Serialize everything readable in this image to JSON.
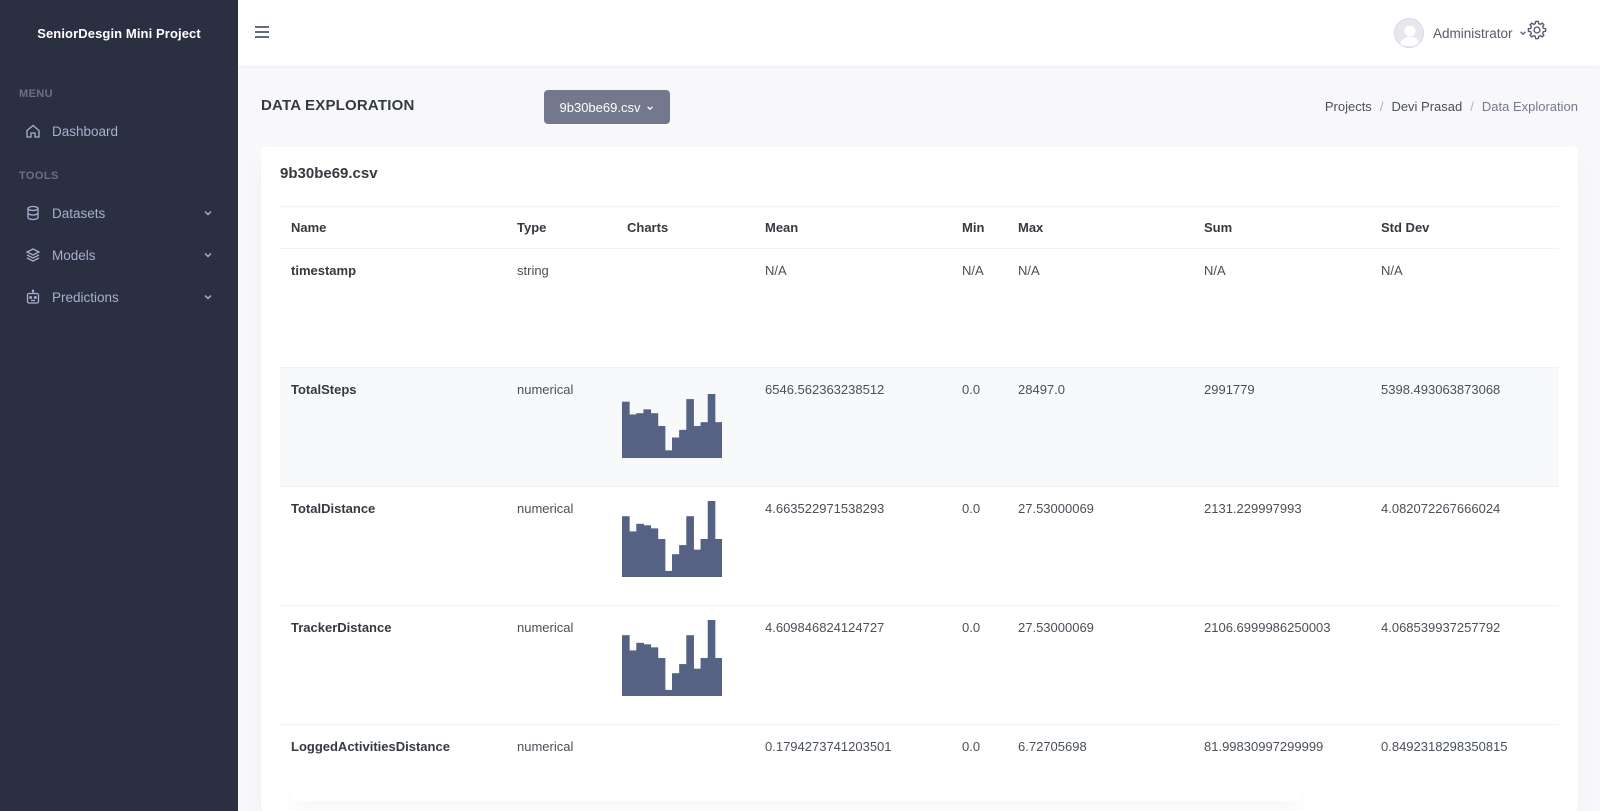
{
  "brand": "SeniorDesgin Mini Project",
  "sidebar": {
    "menu_title": "MENU",
    "tools_title": "TOOLS",
    "items": [
      {
        "label": "Dashboard",
        "icon": "home-icon"
      },
      {
        "label": "Datasets",
        "icon": "database-icon"
      },
      {
        "label": "Models",
        "icon": "layers-icon"
      },
      {
        "label": "Predictions",
        "icon": "bot-icon"
      }
    ]
  },
  "topbar": {
    "user_name": "Administrator"
  },
  "page": {
    "title": "DATA EXPLORATION",
    "file_dropdown": "9b30be69.csv",
    "breadcrumb": [
      "Projects",
      "Devi Prasad",
      "Data Exploration"
    ]
  },
  "card": {
    "title": "9b30be69.csv",
    "columns": [
      "Name",
      "Type",
      "Charts",
      "Mean",
      "Min",
      "Max",
      "Sum",
      "Std Dev"
    ],
    "rows": [
      {
        "name": "timestamp",
        "type": "string",
        "mean": "N/A",
        "min": "N/A",
        "max": "N/A",
        "sum": "N/A",
        "std": "N/A",
        "hist": []
      },
      {
        "name": "TotalSteps",
        "type": "numerical",
        "mean": "6546.562363238512",
        "min": "0.0",
        "max": "28497.0",
        "sum": "2991779",
        "std": "5398.493063873068",
        "hist": [
          0.88,
          0.68,
          0.7,
          0.76,
          0.7,
          0.5,
          0.12,
          0.32,
          0.44,
          0.92,
          0.5,
          0.56,
          1.0,
          0.56
        ]
      },
      {
        "name": "TotalDistance",
        "type": "numerical",
        "mean": "4.663522971538293",
        "min": "0.0",
        "max": "27.53000069",
        "sum": "2131.229997993",
        "std": "4.082072267666024",
        "hist": [
          0.8,
          0.6,
          0.7,
          0.68,
          0.64,
          0.5,
          0.08,
          0.3,
          0.42,
          0.8,
          0.36,
          0.5,
          1.0,
          0.5
        ]
      },
      {
        "name": "TrackerDistance",
        "type": "numerical",
        "mean": "4.609846824124727",
        "min": "0.0",
        "max": "27.53000069",
        "sum": "2106.6999986250003",
        "std": "4.068539937257792",
        "hist": [
          0.8,
          0.6,
          0.7,
          0.68,
          0.64,
          0.5,
          0.08,
          0.3,
          0.42,
          0.8,
          0.36,
          0.5,
          1.0,
          0.5
        ]
      },
      {
        "name": "LoggedActivitiesDistance",
        "type": "numerical",
        "mean": "0.1794273741203501",
        "min": "0.0",
        "max": "6.72705698",
        "sum": "81.99830997299999",
        "std": "0.8492318298350815",
        "hist": []
      }
    ]
  },
  "colors": {
    "sidebar_bg": "#2a3042",
    "hist_fill": "#556284",
    "dropdown_bg": "#74788d"
  }
}
